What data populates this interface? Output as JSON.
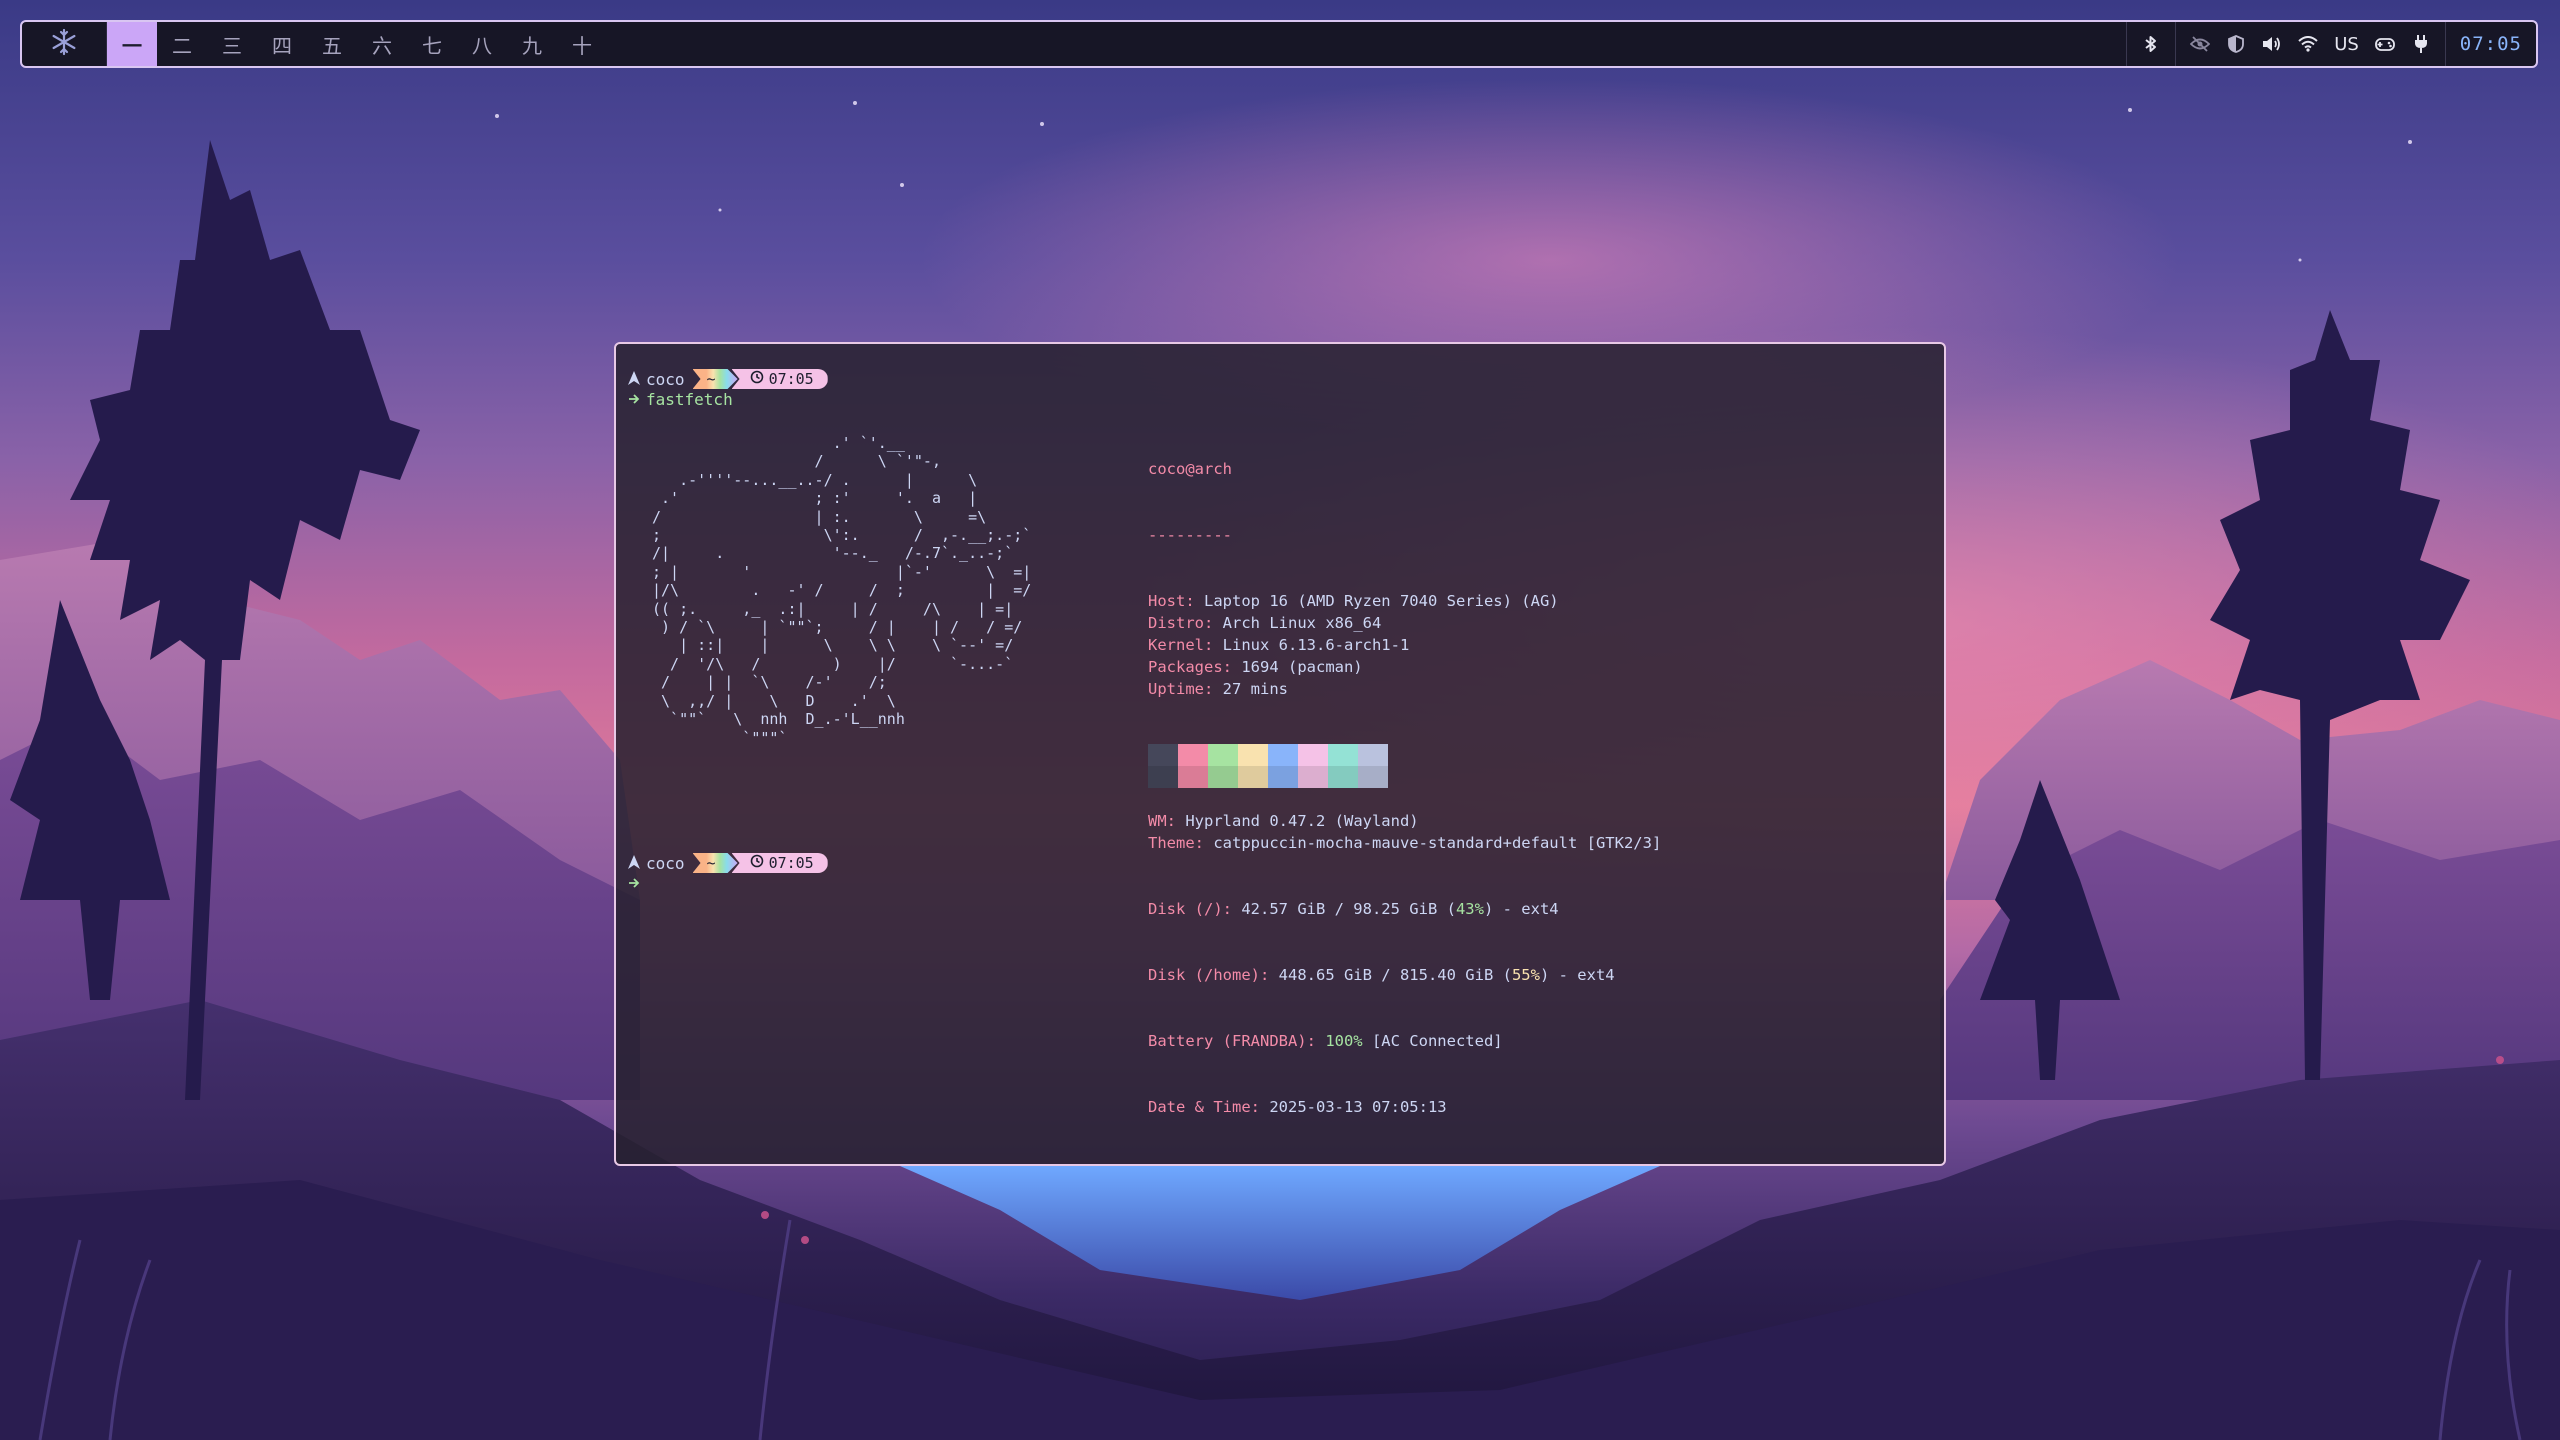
{
  "topbar": {
    "workspaces": [
      "一",
      "二",
      "三",
      "四",
      "五",
      "六",
      "七",
      "八",
      "九",
      "十"
    ],
    "active_workspace": 0,
    "keyboard_layout": "US",
    "clock": "07:05"
  },
  "terminal": {
    "prompt1": {
      "user": "coco",
      "dir": "~",
      "time": "07:05"
    },
    "command": "fastfetch",
    "ascii_art": [
      "                    .' `'.__",
      "                  /      \\ `'\"-,",
      "   .-''''--...__..-/ .      |      \\",
      " .'               ; :'     '.  a   |",
      "/                 | :.       \\     =\\",
      ";                  \\':.      /  ,-.__;.-;`",
      "/|     .            '--._   /-.7`._..-;`",
      "; |       '                |`-'      \\  =|",
      "|/\\        .   -' /     /  ;         |  =/",
      "(( ;.     ,_  .:|     | /     /\\    | =|",
      " ) / `\\     | `\"\"`;     / |    | /   / =/",
      "   | ::|    |      \\    \\ \\    \\ `--' =/",
      "  /  '/\\   /        )    |/      `-...-`",
      " /    | |  `\\    /-'    /;",
      " \\  ,,/ |    \\   D    .'  \\",
      "  `\"\"`   \\  nnh  D_.-'L__nnh",
      "          `\"\"\"`"
    ],
    "info": {
      "userhost": "coco@arch",
      "separator": "---------",
      "rows1": [
        {
          "key": "Host",
          "value": "Laptop 16 (AMD Ryzen 7040 Series) (AG)"
        },
        {
          "key": "Distro",
          "value": "Arch Linux x86_64"
        },
        {
          "key": "Kernel",
          "value": "Linux 6.13.6-arch1-1"
        },
        {
          "key": "Packages",
          "value": "1694 (pacman)"
        },
        {
          "key": "Uptime",
          "value": "27 mins"
        }
      ],
      "rows2": [
        {
          "key": "WM",
          "value": "Hyprland 0.47.2 (Wayland)"
        },
        {
          "key": "Theme",
          "value": "catppuccin-mocha-mauve-standard+default [GTK2/3]"
        }
      ],
      "disk_root": {
        "key": "Disk (/)",
        "pre": "42.57 GiB / 98.25 GiB (",
        "pct": "43%",
        "post": ") - ext4"
      },
      "disk_home": {
        "key": "Disk (/home)",
        "pre": "448.65 GiB / 815.40 GiB (",
        "pct": "55%",
        "post": ") - ext4"
      },
      "battery": {
        "key": "Battery (FRANDBA)",
        "pct": "100%",
        "post": " [AC Connected]"
      },
      "datetime": {
        "key": "Date & Time",
        "value": "2025-03-13 07:05:13"
      }
    },
    "palette": [
      "#45475a",
      "#f38ba8",
      "#a6e3a1",
      "#f9e2af",
      "#89b4fa",
      "#f5c2e7",
      "#94e2d5",
      "#bac2de"
    ],
    "prompt2": {
      "user": "coco",
      "dir": "~",
      "time": "07:05"
    }
  },
  "icons": {
    "launcher": "snowflake-logo-icon",
    "tray": [
      "bluetooth-icon",
      "eye-off-icon",
      "shield-icon",
      "volume-icon",
      "wifi-icon",
      "keyboard-layout",
      "controller-icon",
      "power-plug-icon"
    ]
  }
}
